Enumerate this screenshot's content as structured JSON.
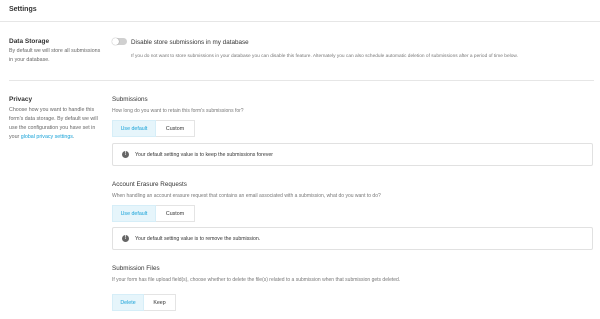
{
  "header": {
    "title": "Settings"
  },
  "data_storage": {
    "title": "Data Storage",
    "description": "By default we will store all submissions in your database.",
    "toggle_label": "Disable store submissions in my database",
    "toggle_help": "If you do not want to store submissions in your database you can disable this feature. Alternately you can also schedule automatic deletion of submissions after a period of time below.",
    "toggle_on": false
  },
  "privacy": {
    "title": "Privacy",
    "description": "Choose how you want to handle this form's data storage. By default we will use the configuration you have set in your",
    "link_text": "global privacy settings",
    "link_suffix": "."
  },
  "submissions": {
    "title": "Submissions",
    "description": "How long do you want to retain this form's submissions for?",
    "options": [
      "Use default",
      "Custom"
    ],
    "selected": "Use default",
    "notice": "Your default setting value is to keep the submissions forever"
  },
  "erasure": {
    "title": "Account Erasure Requests",
    "description": "When handling an account erasure request that contains an email associated with a submission, what do you want to do?",
    "options": [
      "Use default",
      "Custom"
    ],
    "selected": "Use default",
    "notice": "Your default setting value is to remove the submission."
  },
  "files": {
    "title": "Submission Files",
    "description": "If your form has file upload field(s), choose whether to delete the file(s) related to a submission when that submission gets deleted.",
    "options": [
      "Delete",
      "Keep"
    ],
    "selected": "Delete"
  },
  "icons": {
    "notice": "info-circle-icon"
  },
  "colors": {
    "accent": "#17a2d8",
    "active_bg": "#e6f5fb"
  }
}
